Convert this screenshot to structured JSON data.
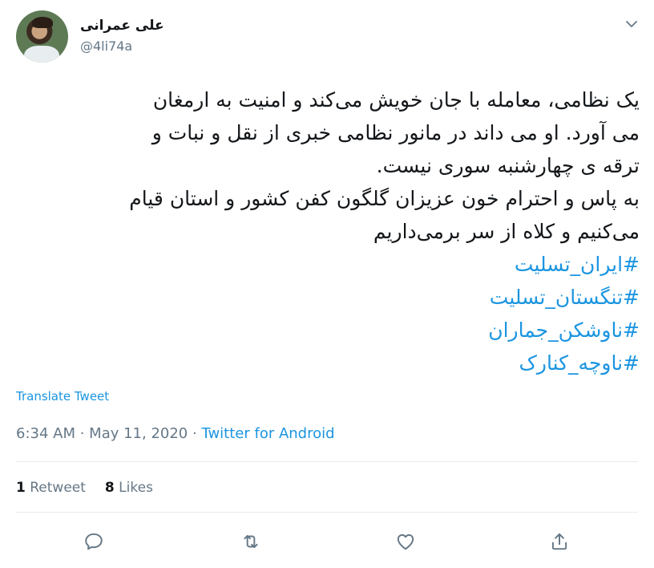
{
  "author": {
    "display_name": "علی عمرانی",
    "handle": "@4li74a"
  },
  "tweet": {
    "lines": [
      "یک نظامی، معامله با جان خویش می‌کند و امنیت به ارمغان",
      "می آورد. او می داند در مانور نظامی خبری از نقل و نبات و",
      "ترقه ی چهارشنبه سوری نیست.",
      "به پاس و احترام خون عزیزان گلگون کفن کشور و استان قیام",
      "می‌کنیم و کلاه از سر برمی‌داریم"
    ],
    "hashtags": [
      "#ایران_تسلیت",
      "#تنگستان_تسلیت",
      "#ناوشکن_جماران",
      "#ناوچه_کنارک"
    ]
  },
  "translate_label": "Translate Tweet",
  "meta": {
    "time": "6:34 AM",
    "separator": " · ",
    "date": "May 11, 2020",
    "source": "Twitter for Android"
  },
  "stats": {
    "retweets_count": "1",
    "retweets_label": "Retweet",
    "likes_count": "8",
    "likes_label": "Likes"
  },
  "icons": {
    "reply": "reply-icon",
    "retweet": "retweet-icon",
    "like": "heart-icon",
    "share": "share-icon",
    "caret": "chevron-down-icon"
  }
}
